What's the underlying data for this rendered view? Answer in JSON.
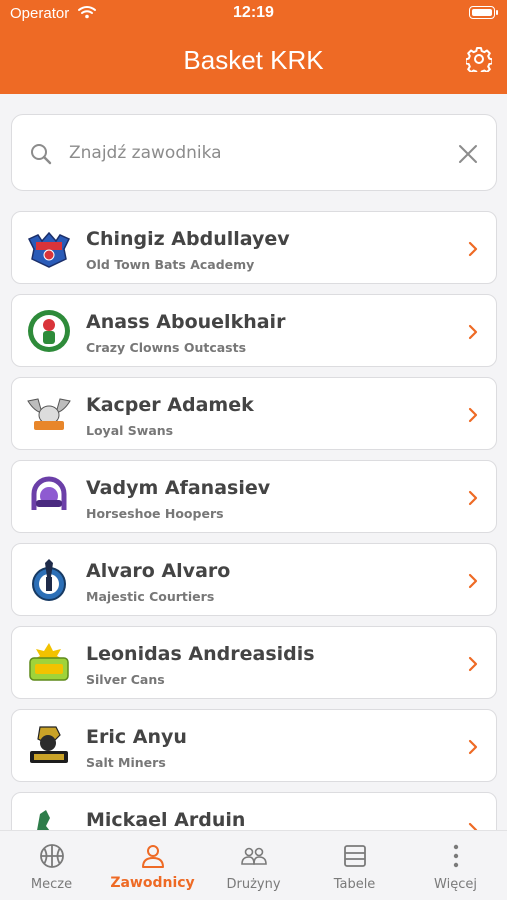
{
  "status_bar": {
    "carrier": "Operator",
    "time": "12:19"
  },
  "header": {
    "title": "Basket KRK"
  },
  "search": {
    "placeholder": "Znajdź zawodnika",
    "value": ""
  },
  "players": [
    {
      "name": "Chingiz Abdullayev",
      "team": "Old Town Bats Academy"
    },
    {
      "name": "Anass Abouelkhair",
      "team": "Crazy Clowns Outcasts"
    },
    {
      "name": "Kacper Adamek",
      "team": "Loyal Swans"
    },
    {
      "name": "Vadym Afanasiev",
      "team": "Horseshoe Hoopers"
    },
    {
      "name": "Alvaro Alvaro",
      "team": "Majestic Courtiers"
    },
    {
      "name": "Leonidas Andreasidis",
      "team": "Silver Cans"
    },
    {
      "name": "Eric Anyu",
      "team": "Salt Miners"
    },
    {
      "name": "Mickael Arduin",
      "team": ""
    }
  ],
  "tabs": [
    {
      "label": "Mecze",
      "icon": "basketball-icon"
    },
    {
      "label": "Zawodnicy",
      "icon": "person-icon"
    },
    {
      "label": "Drużyny",
      "icon": "people-icon"
    },
    {
      "label": "Tabele",
      "icon": "table-icon"
    },
    {
      "label": "Więcej",
      "icon": "more-vertical-icon"
    }
  ],
  "colors": {
    "accent": "#ee6a25",
    "background": "#f4f4f6",
    "card": "#ffffff",
    "text": "#444444",
    "muted": "#777777"
  }
}
